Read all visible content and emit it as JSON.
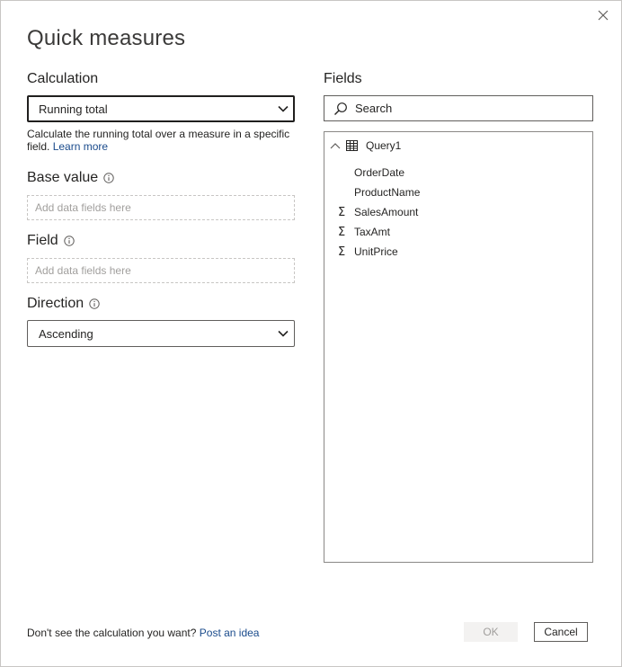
{
  "dialog": {
    "title": "Quick measures"
  },
  "calculation": {
    "label": "Calculation",
    "selected": "Running total",
    "description": "Calculate the running total over a measure in a specific field.",
    "learn_more": "Learn more"
  },
  "base_value": {
    "label": "Base value",
    "placeholder": "Add data fields here"
  },
  "field": {
    "label": "Field",
    "placeholder": "Add data fields here"
  },
  "direction": {
    "label": "Direction",
    "selected": "Ascending"
  },
  "fields": {
    "label": "Fields",
    "search_placeholder": "Search",
    "table_name": "Query1",
    "items": [
      {
        "name": "OrderDate",
        "sigma": ""
      },
      {
        "name": "ProductName",
        "sigma": ""
      },
      {
        "name": "SalesAmount",
        "sigma": "Σ"
      },
      {
        "name": "TaxAmt",
        "sigma": "Σ"
      },
      {
        "name": "UnitPrice",
        "sigma": "Σ"
      }
    ]
  },
  "footer": {
    "prompt": "Don't see the calculation you want?",
    "link": "Post an idea",
    "ok_label": "OK",
    "cancel_label": "Cancel"
  },
  "icons": {
    "close": "close-icon",
    "info": "info-icon",
    "chevron": "chevron-down-icon",
    "search": "search-icon",
    "table": "table-icon",
    "collapse": "chevron-up-icon",
    "sigma": "sigma-icon"
  }
}
